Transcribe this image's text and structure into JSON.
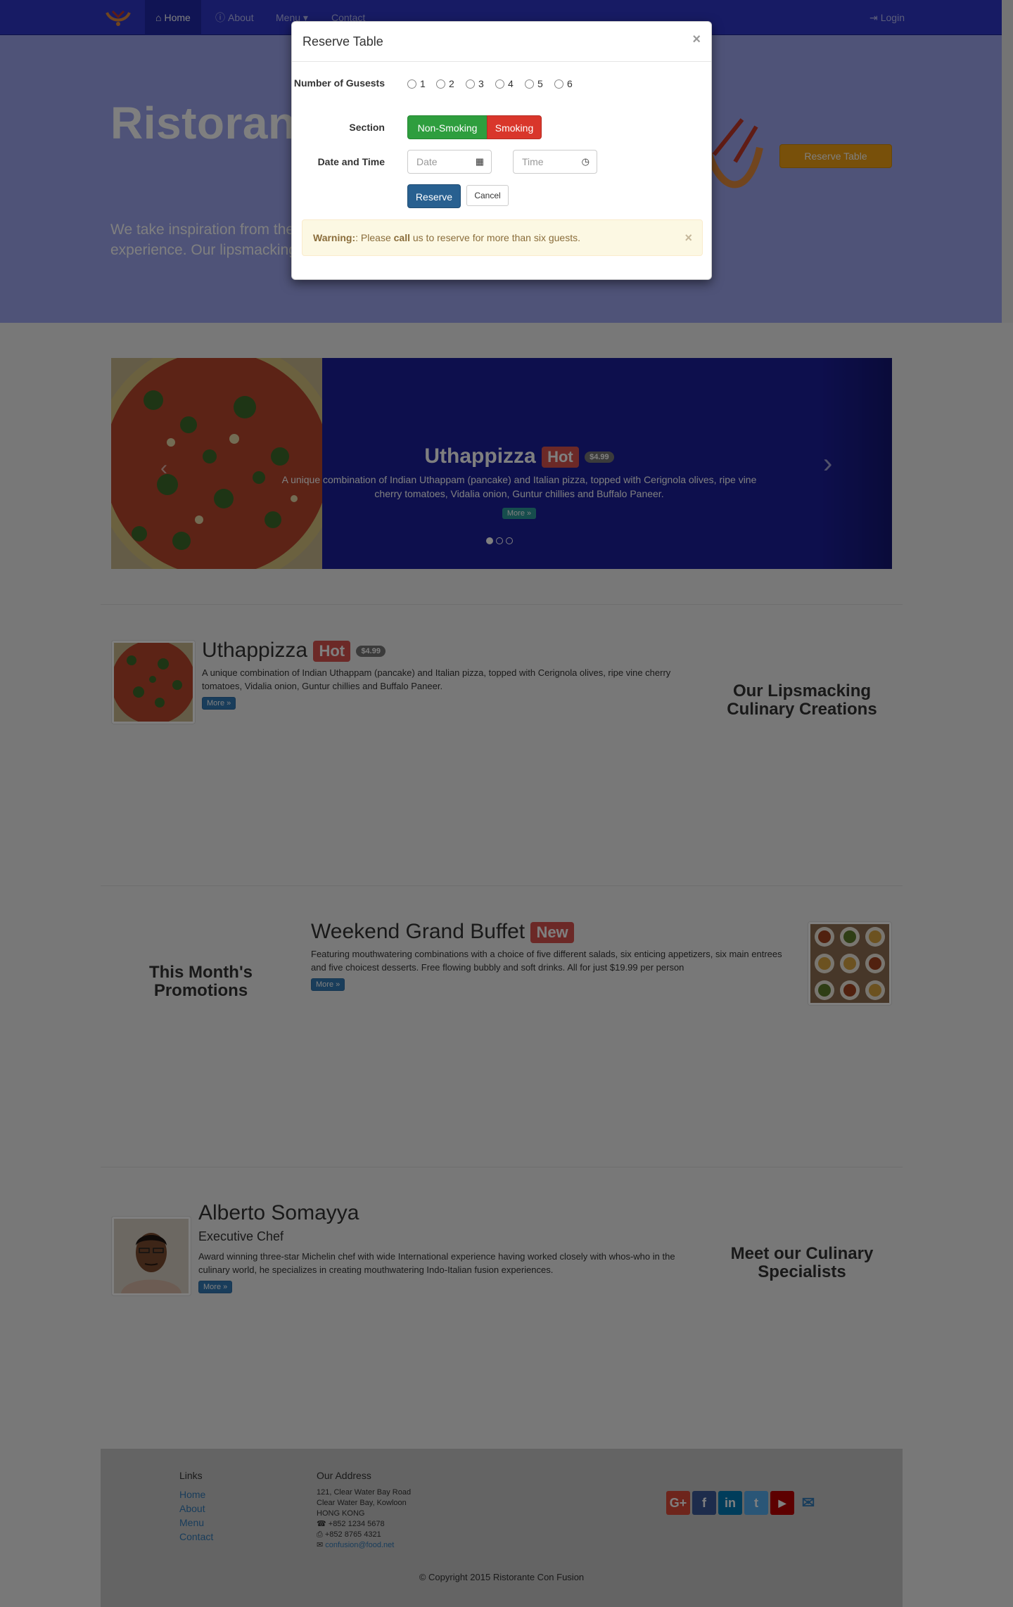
{
  "navbar": {
    "items": [
      {
        "label": "Home",
        "icon": "home-icon"
      },
      {
        "label": "About",
        "icon": "info-icon"
      },
      {
        "label": "Menu",
        "icon": "caret-down-icon"
      },
      {
        "label": "Contact",
        "icon": ""
      }
    ],
    "login_label": "Login",
    "brand_color": "#2f36c8"
  },
  "jumbotron": {
    "title": "Ristorante",
    "text": "We take inspiration from the W",
    "text2": "experience. Our lipsmacking c",
    "reserve_label": "Reserve Table"
  },
  "carousel": {
    "title": "Uthappizza",
    "label": "Hot",
    "price": "$4.99",
    "description": "A unique combination of Indian Uthappam (pancake) and Italian pizza, topped with Cerignola olives, ripe vine cherry tomatoes, Vidalia onion, Guntur chillies and Buffalo Paneer.",
    "more_label": "More »",
    "slides": 3
  },
  "dish": {
    "title": "Uthappizza",
    "label": "Hot",
    "price": "$4.99",
    "description": "A unique combination of Indian Uthappam (pancake) and Italian pizza, topped with Cerignola olives, ripe vine cherry tomatoes, Vidalia onion, Guntur chillies and Buffalo Paneer.",
    "more_label": "More »",
    "side_heading": "Our Lipsmacking Culinary Creations"
  },
  "promotion": {
    "title": "Weekend Grand Buffet",
    "label": "New",
    "description": "Featuring mouthwatering combinations with a choice of five different salads, six enticing appetizers, six main entrees and five choicest desserts. Free flowing bubbly and soft drinks. All for just $19.99 per person",
    "more_label": "More »",
    "side_heading": "This Month's Promotions"
  },
  "chef": {
    "name": "Alberto Somayya",
    "role": "Executive Chef",
    "description": "Award winning three-star Michelin chef with wide International experience having worked closely with whos-who in the culinary world, he specializes in creating mouthwatering Indo-Italian fusion experiences.",
    "more_label": "More »",
    "side_heading": "Meet our Culinary Specialists"
  },
  "footer": {
    "links_heading": "Links",
    "links": [
      "Home",
      "About",
      "Menu",
      "Contact"
    ],
    "address_heading": "Our Address",
    "address": [
      "121, Clear Water Bay Road",
      "Clear Water Bay, Kowloon",
      "HONG KONG"
    ],
    "phone": "+852 1234 5678",
    "fax": "+852 8765 4321",
    "email": "confusion@food.net",
    "social": [
      {
        "icon": "google-plus-icon",
        "color": "#dd4b39",
        "glyph": "G+"
      },
      {
        "icon": "facebook-icon",
        "color": "#3b5998",
        "glyph": "f"
      },
      {
        "icon": "linkedin-icon",
        "color": "#007bb6",
        "glyph": "in"
      },
      {
        "icon": "twitter-icon",
        "color": "#55acee",
        "glyph": "t"
      },
      {
        "icon": "youtube-icon",
        "color": "#bb0000",
        "glyph": "▶"
      },
      {
        "icon": "envelope-icon",
        "color": "",
        "glyph": "✉"
      }
    ],
    "copyright": "© Copyright 2015 Ristorante Con Fusion"
  },
  "modal": {
    "title": "Reserve Table",
    "close_glyph": "×",
    "guests_label": "Number of Gusests",
    "guest_options": [
      "1",
      "2",
      "3",
      "4",
      "5",
      "6"
    ],
    "section_label": "Section",
    "section_options": [
      "Non-Smoking",
      "Smoking"
    ],
    "datetime_label": "Date and Time",
    "date_placeholder": "Date",
    "time_placeholder": "Time",
    "reserve_label": "Reserve",
    "cancel_label": "Cancel",
    "alert": {
      "strong": "Warning:",
      "text_before": ": Please ",
      "strong2": "call",
      "text_after": " us to reserve for more than six guests."
    }
  }
}
